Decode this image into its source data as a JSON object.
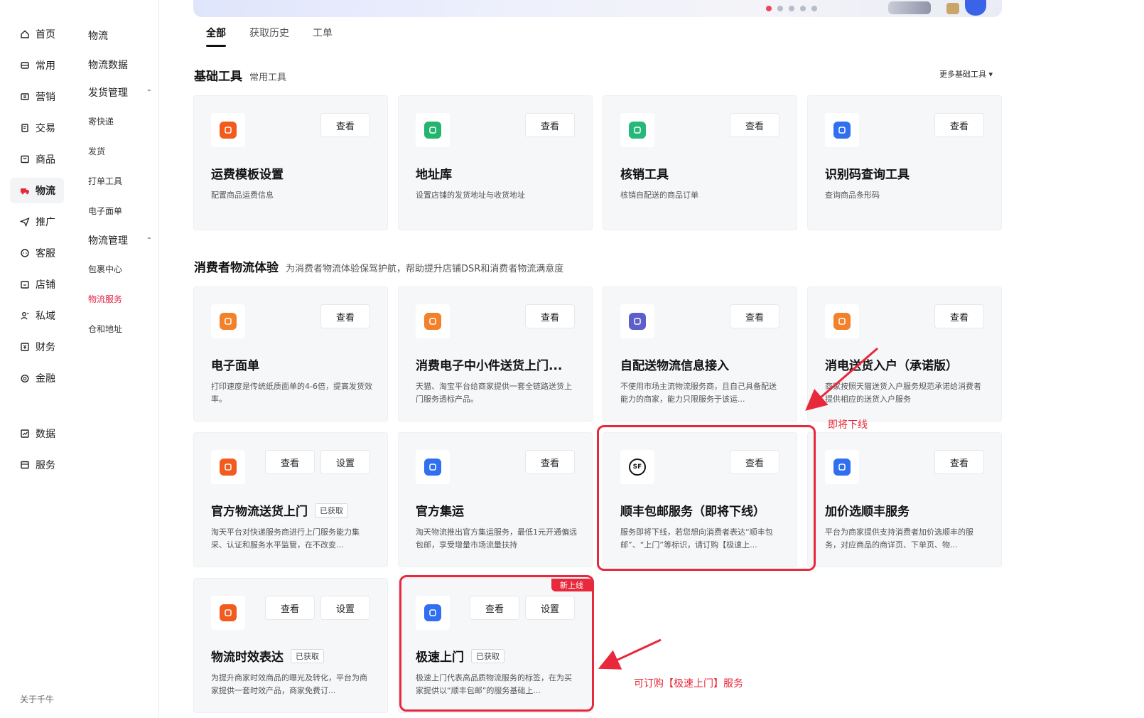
{
  "sidebar": {
    "items": [
      {
        "label": "首页",
        "icon": "home-icon"
      },
      {
        "label": "常用",
        "icon": "pin-icon"
      },
      {
        "label": "营销",
        "icon": "ticket-icon"
      },
      {
        "label": "交易",
        "icon": "receipt-icon"
      },
      {
        "label": "商品",
        "icon": "box-icon"
      },
      {
        "label": "物流",
        "icon": "truck-icon",
        "active": true
      },
      {
        "label": "推广",
        "icon": "send-icon"
      },
      {
        "label": "客服",
        "icon": "chat-icon"
      },
      {
        "label": "店铺",
        "icon": "store-icon"
      },
      {
        "label": "私域",
        "icon": "users-icon"
      },
      {
        "label": "财务",
        "icon": "finance-icon"
      },
      {
        "label": "金融",
        "icon": "coin-icon"
      },
      {
        "label": "数据",
        "icon": "chart-icon"
      },
      {
        "label": "服务",
        "icon": "service-icon"
      }
    ],
    "about": "关于千牛",
    "sub": {
      "title": "物流",
      "logistics_data": "物流数据",
      "group1": "发货管理",
      "group1_items": [
        "寄快递",
        "发货",
        "打单工具",
        "电子面单"
      ],
      "group2": "物流管理",
      "group2_items": [
        "包裹中心",
        "物流服务",
        "仓和地址"
      ],
      "active_item": "物流服务"
    }
  },
  "tabs": [
    "全部",
    "获取历史",
    "工单"
  ],
  "basic": {
    "title": "基础工具",
    "subtitle": "常用工具",
    "more": "更多基础工具"
  },
  "consumer": {
    "title": "消费者物流体验",
    "subtitle": "为消费者物流体验保驾护航，帮助提升店铺DSR和消费者物流满意度"
  },
  "buttons": {
    "view": "查看",
    "settings": "设置"
  },
  "cards": [
    {
      "title": "运费模板设置",
      "desc": "配置商品运费信息",
      "color": "#f25b1d"
    },
    {
      "title": "地址库",
      "desc": "设置店铺的发货地址与收货地址",
      "color": "#23b56f"
    },
    {
      "title": "核销工具",
      "desc": "核销自配送的商品订单",
      "color": "#26b87a"
    },
    {
      "title": "识别码查询工具",
      "desc": "查询商品条形码",
      "color": "#2f6ff0"
    },
    {
      "title": "电子面单",
      "desc": "打印速度是传统纸质面单的4-6倍，提高发货效率。",
      "color": "#f3812c"
    },
    {
      "title": "消费电子中小件送货上门...",
      "desc": "天猫、淘宝平台给商家提供一套全链路送货上门服务透标产品。",
      "color": "#f3812c"
    },
    {
      "title": "自配送物流信息接入",
      "desc": "不使用市场主流物流服务商，且自己具备配送能力的商家，能力只限服务于该运...",
      "color": "#5b5fc7"
    },
    {
      "title": "消电送货入户（承诺版）",
      "desc": "商家按照天猫送货入户服务规范承诺给消费者提供相应的送货入户服务",
      "color": "#f3812c"
    },
    {
      "title": "官方物流送货上门",
      "tag": "已获取",
      "desc": "淘天平台对快递服务商进行上门服务能力集采、认证和服务水平监管，在不改变...",
      "color": "#f25b1d"
    },
    {
      "title": "官方集运",
      "desc": "淘天物流推出官方集运服务，最低1元开通偏远包邮，享受增量市场流量扶持",
      "color": "#2f6ff0"
    },
    {
      "title": "顺丰包邮服务（即将下线）",
      "desc": "服务即将下线，若您想向消费者表达“顺丰包邮”、“上门”等标识，请订购【极速上...",
      "color": "#111111",
      "glyph": "SF"
    },
    {
      "title": "加价选顺丰服务",
      "desc": "平台为商家提供支持消费者加价选顺丰的服务，对应商品的商详页、下单页、物...",
      "color": "#2f6ff0"
    },
    {
      "title": "物流时效表达",
      "tag": "已获取",
      "desc": "为提升商家时效商品的曝光及转化，平台为商家提供一套时效产品，商家免费订...",
      "color": "#f25b1d"
    },
    {
      "title": "极速上门",
      "tag": "已获取",
      "desc": "极速上门代表高品质物流服务的标签，在为买家提供以“顺丰包邮”的服务基础上...",
      "color": "#2f6ff0",
      "badge": "新上线"
    }
  ],
  "annotations": {
    "offline": "即将下线",
    "subscribe": "可订购【极速上门】服务"
  }
}
